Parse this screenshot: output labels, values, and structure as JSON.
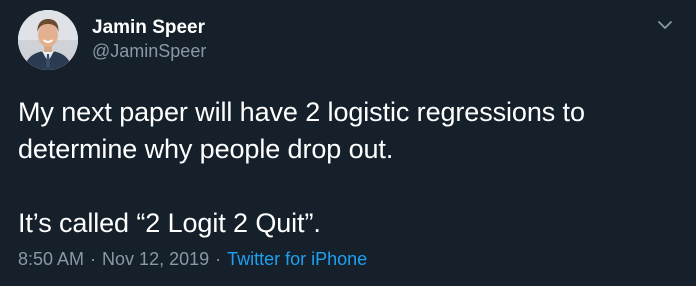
{
  "tweet": {
    "author": {
      "display_name": "Jamin Speer",
      "handle": "@JaminSpeer",
      "avatar": "profile-photo"
    },
    "menu_icon": "chevron-down-icon",
    "text": "My next paper will have 2 logistic regressions to determine why people drop out.\n\nIt’s called “2 Logit 2 Quit”.",
    "time": "8:50 AM",
    "separator": "·",
    "date": "Nov 12, 2019",
    "source": "Twitter for iPhone"
  },
  "colors": {
    "background": "#15202b",
    "primary_text": "#ffffff",
    "secondary_text": "#8899a6",
    "link": "#1da1f2"
  }
}
